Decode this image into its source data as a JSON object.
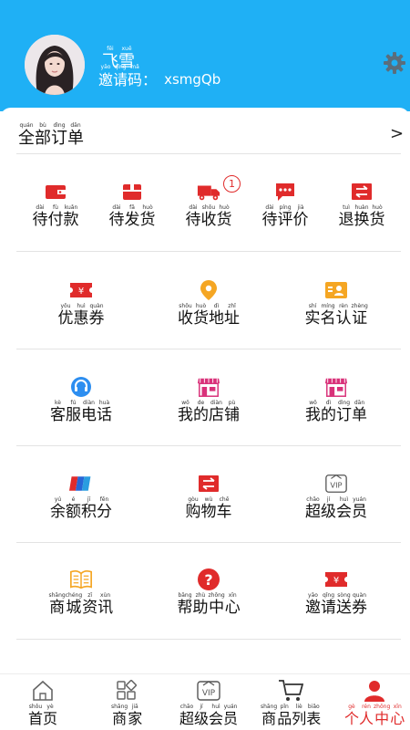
{
  "header": {
    "username": [
      {
        "py": "fēi",
        "hz": "飞"
      },
      {
        "py": "xuě",
        "hz": "雪"
      }
    ],
    "invite_label": [
      {
        "py": "yāo",
        "hz": "邀"
      },
      {
        "py": "qǐng",
        "hz": "请"
      },
      {
        "py": "mǎ",
        "hz": "码"
      }
    ],
    "invite_colon": "：",
    "invite_code": "xsmgQb",
    "settings_icon": "gear-icon",
    "colors": {
      "header_bg": "#1fb0f5",
      "accent_red": "#e02b2b",
      "accent_orange": "#f5a623"
    }
  },
  "all_orders": {
    "label": [
      {
        "py": "quán",
        "hz": "全"
      },
      {
        "py": "bù",
        "hz": "部"
      },
      {
        "py": "dìng",
        "hz": "订"
      },
      {
        "py": "dān",
        "hz": "单"
      }
    ],
    "chevron": ">"
  },
  "order_status": [
    {
      "icon": "wallet-icon",
      "label": [
        {
          "py": "dài",
          "hz": "待"
        },
        {
          "py": "fù",
          "hz": "付"
        },
        {
          "py": "kuǎn",
          "hz": "款"
        }
      ]
    },
    {
      "icon": "package-icon",
      "label": [
        {
          "py": "dài",
          "hz": "待"
        },
        {
          "py": "fā",
          "hz": "发"
        },
        {
          "py": "huò",
          "hz": "货"
        }
      ]
    },
    {
      "icon": "truck-icon",
      "badge": "1",
      "label": [
        {
          "py": "dài",
          "hz": "待"
        },
        {
          "py": "shōu",
          "hz": "收"
        },
        {
          "py": "huò",
          "hz": "货"
        }
      ]
    },
    {
      "icon": "comment-icon",
      "label": [
        {
          "py": "dài",
          "hz": "待"
        },
        {
          "py": "píng",
          "hz": "评"
        },
        {
          "py": "jià",
          "hz": "价"
        }
      ]
    },
    {
      "icon": "exchange-icon",
      "label": [
        {
          "py": "tuì",
          "hz": "退"
        },
        {
          "py": "huàn",
          "hz": "换"
        },
        {
          "py": "huò",
          "hz": "货"
        }
      ]
    }
  ],
  "grid": [
    [
      {
        "icon": "coupon-icon",
        "label": [
          {
            "py": "yōu",
            "hz": "优"
          },
          {
            "py": "huì",
            "hz": "惠"
          },
          {
            "py": "quàn",
            "hz": "券"
          }
        ]
      },
      {
        "icon": "location-pin-icon",
        "label": [
          {
            "py": "shōu",
            "hz": "收"
          },
          {
            "py": "huò",
            "hz": "货"
          },
          {
            "py": "dì",
            "hz": "地"
          },
          {
            "py": "zhǐ",
            "hz": "址"
          }
        ]
      },
      {
        "icon": "id-card-icon",
        "label": [
          {
            "py": "shí",
            "hz": "实"
          },
          {
            "py": "míng",
            "hz": "名"
          },
          {
            "py": "rèn",
            "hz": "认"
          },
          {
            "py": "zhèng",
            "hz": "证"
          }
        ]
      }
    ],
    [
      {
        "icon": "headset-icon",
        "label": [
          {
            "py": "kè",
            "hz": "客"
          },
          {
            "py": "fú",
            "hz": "服"
          },
          {
            "py": "diàn",
            "hz": "电"
          },
          {
            "py": "huà",
            "hz": "话"
          }
        ]
      },
      {
        "icon": "store-icon",
        "label": [
          {
            "py": "wǒ",
            "hz": "我"
          },
          {
            "py": "de",
            "hz": "的"
          },
          {
            "py": "diàn",
            "hz": "店"
          },
          {
            "py": "pù",
            "hz": "铺"
          }
        ]
      },
      {
        "icon": "store-icon",
        "label": [
          {
            "py": "wǒ",
            "hz": "我"
          },
          {
            "py": "dì",
            "hz": "的"
          },
          {
            "py": "dìng",
            "hz": "订"
          },
          {
            "py": "dān",
            "hz": "单"
          }
        ]
      }
    ],
    [
      {
        "icon": "balance-cards-icon",
        "label": [
          {
            "py": "yú",
            "hz": "余"
          },
          {
            "py": "é",
            "hz": "额"
          },
          {
            "py": "jī",
            "hz": "积"
          },
          {
            "py": "fēn",
            "hz": "分"
          }
        ]
      },
      {
        "icon": "exchange-icon",
        "label": [
          {
            "py": "gòu",
            "hz": "购"
          },
          {
            "py": "wù",
            "hz": "物"
          },
          {
            "py": "chē",
            "hz": "车"
          }
        ]
      },
      {
        "icon": "vip-icon",
        "label": [
          {
            "py": "chāo",
            "hz": "超"
          },
          {
            "py": "jí",
            "hz": "级"
          },
          {
            "py": "huì",
            "hz": "会"
          },
          {
            "py": "yuán",
            "hz": "员"
          }
        ]
      }
    ],
    [
      {
        "icon": "book-icon",
        "label": [
          {
            "py": "shāng",
            "hz": "商"
          },
          {
            "py": "chéng",
            "hz": "城"
          },
          {
            "py": "zī",
            "hz": "资"
          },
          {
            "py": "xùn",
            "hz": "讯"
          }
        ]
      },
      {
        "icon": "help-icon",
        "label": [
          {
            "py": "bāng",
            "hz": "帮"
          },
          {
            "py": "zhù",
            "hz": "助"
          },
          {
            "py": "zhōng",
            "hz": "中"
          },
          {
            "py": "xīn",
            "hz": "心"
          }
        ]
      },
      {
        "icon": "coupon-icon",
        "label": [
          {
            "py": "yāo",
            "hz": "邀"
          },
          {
            "py": "qǐng",
            "hz": "请"
          },
          {
            "py": "sòng",
            "hz": "送"
          },
          {
            "py": "quàn",
            "hz": "券"
          }
        ]
      }
    ]
  ],
  "tabs": [
    {
      "icon": "home-icon",
      "active": false,
      "label": [
        {
          "py": "shǒu",
          "hz": "首"
        },
        {
          "py": "yè",
          "hz": "页"
        }
      ]
    },
    {
      "icon": "category-icon",
      "active": false,
      "label": [
        {
          "py": "shāng",
          "hz": "商"
        },
        {
          "py": "jiā",
          "hz": "家"
        }
      ]
    },
    {
      "icon": "vip-icon",
      "active": false,
      "label": [
        {
          "py": "chāo",
          "hz": "超"
        },
        {
          "py": "jí",
          "hz": "级"
        },
        {
          "py": "huì",
          "hz": "会"
        },
        {
          "py": "yuán",
          "hz": "员"
        }
      ]
    },
    {
      "icon": "cart-icon",
      "active": false,
      "label": [
        {
          "py": "shāng",
          "hz": "商"
        },
        {
          "py": "pǐn",
          "hz": "品"
        },
        {
          "py": "liè",
          "hz": "列"
        },
        {
          "py": "biǎo",
          "hz": "表"
        }
      ]
    },
    {
      "icon": "person-icon",
      "active": true,
      "label": [
        {
          "py": "gè",
          "hz": "个"
        },
        {
          "py": "rén",
          "hz": "人"
        },
        {
          "py": "zhōng",
          "hz": "中"
        },
        {
          "py": "xīn",
          "hz": "心"
        }
      ]
    }
  ]
}
